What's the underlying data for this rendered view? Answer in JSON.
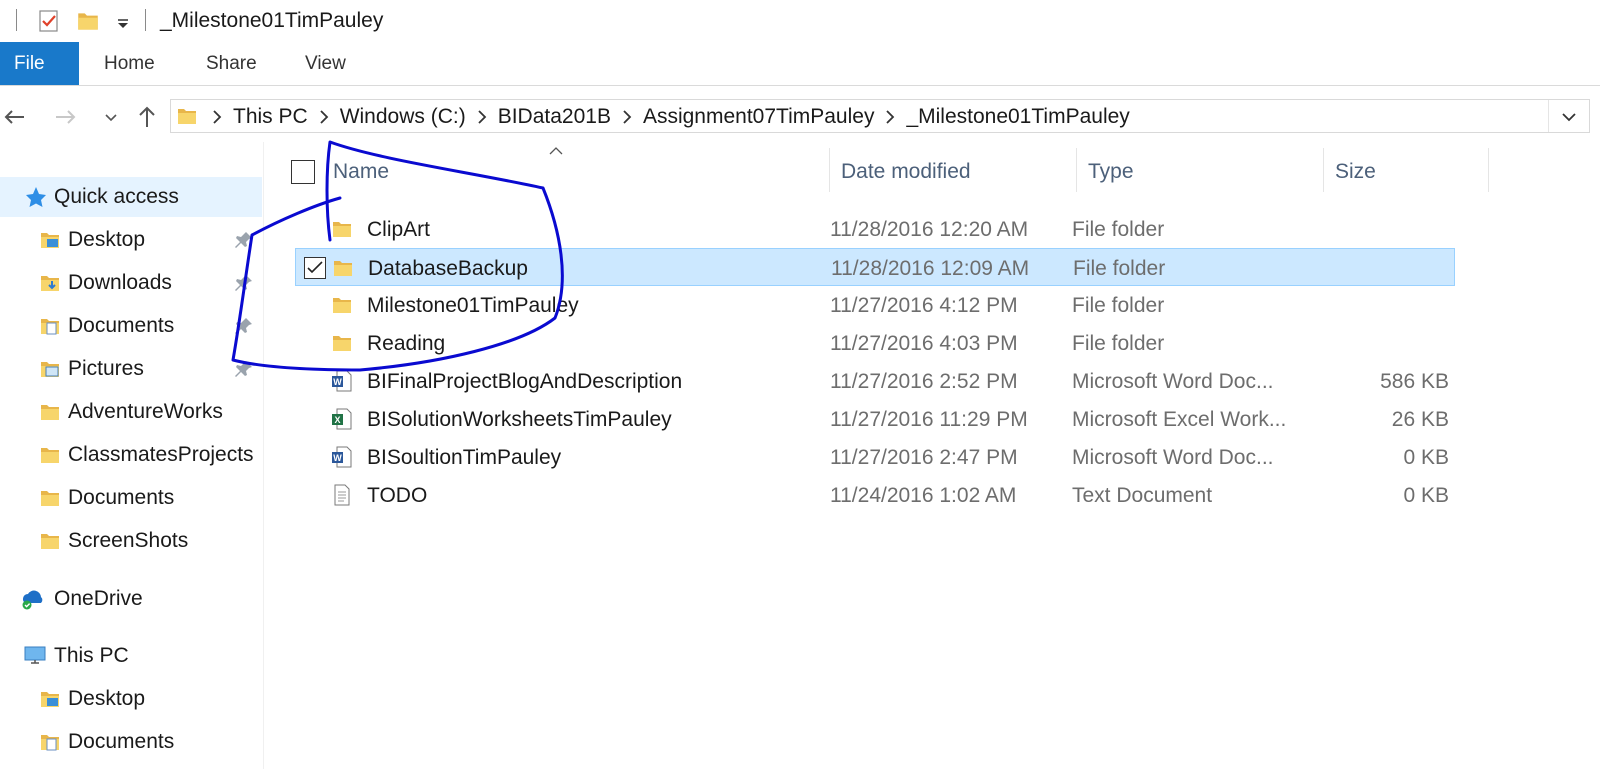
{
  "window": {
    "title": "_Milestone01TimPauley",
    "qat_icons": [
      "properties-icon",
      "new-folder-icon",
      "customize-qat-icon"
    ]
  },
  "ribbon": {
    "tabs": [
      "File",
      "Home",
      "Share",
      "View"
    ]
  },
  "address": {
    "crumbs": [
      "This PC",
      "Windows (C:)",
      "BIData201B",
      "Assignment07TimPauley",
      "_Milestone01TimPauley"
    ]
  },
  "nav_pane": {
    "quick_access": "Quick access",
    "pinned": [
      {
        "label": "Desktop",
        "icon": "desktop-folder-icon"
      },
      {
        "label": "Downloads",
        "icon": "downloads-folder-icon"
      },
      {
        "label": "Documents",
        "icon": "documents-folder-icon"
      },
      {
        "label": "Pictures",
        "icon": "pictures-folder-icon"
      }
    ],
    "folders": [
      "AdventureWorks",
      "ClassmatesProjects",
      "Documents",
      "ScreenShots"
    ],
    "onedrive": "OneDrive",
    "this_pc": "This PC",
    "this_pc_children": [
      "Desktop",
      "Documents"
    ]
  },
  "file_list": {
    "columns": [
      "Name",
      "Date modified",
      "Type",
      "Size"
    ],
    "rows": [
      {
        "name": "ClipArt",
        "date": "11/28/2016 12:20 AM",
        "type": "File folder",
        "size": "",
        "icon": "folder-icon",
        "selected": false
      },
      {
        "name": "DatabaseBackup",
        "date": "11/28/2016 12:09 AM",
        "type": "File folder",
        "size": "",
        "icon": "folder-icon",
        "selected": true
      },
      {
        "name": "Milestone01TimPauley",
        "date": "11/27/2016 4:12 PM",
        "type": "File folder",
        "size": "",
        "icon": "folder-icon",
        "selected": false
      },
      {
        "name": "Reading",
        "date": "11/27/2016 4:03 PM",
        "type": "File folder",
        "size": "",
        "icon": "folder-icon",
        "selected": false
      },
      {
        "name": "BIFinalProjectBlogAndDescription",
        "date": "11/27/2016 2:52 PM",
        "type": "Microsoft Word Doc...",
        "size": "586 KB",
        "icon": "word-doc-icon",
        "selected": false
      },
      {
        "name": "BISolutionWorksheetsTimPauley",
        "date": "11/27/2016 11:29 PM",
        "type": "Microsoft Excel Work...",
        "size": "26 KB",
        "icon": "excel-workbook-icon",
        "selected": false
      },
      {
        "name": "BISoultionTimPauley",
        "date": "11/27/2016 2:47 PM",
        "type": "Microsoft Word Doc...",
        "size": "0 KB",
        "icon": "word-doc-icon",
        "selected": false
      },
      {
        "name": "TODO",
        "date": "11/24/2016 1:02 AM",
        "type": "Text Document",
        "size": "0 KB",
        "icon": "text-doc-icon",
        "selected": false
      }
    ]
  },
  "colors": {
    "accent": "#1979ca",
    "selection": "#cce8ff",
    "annotation_ink": "#0000cc"
  }
}
